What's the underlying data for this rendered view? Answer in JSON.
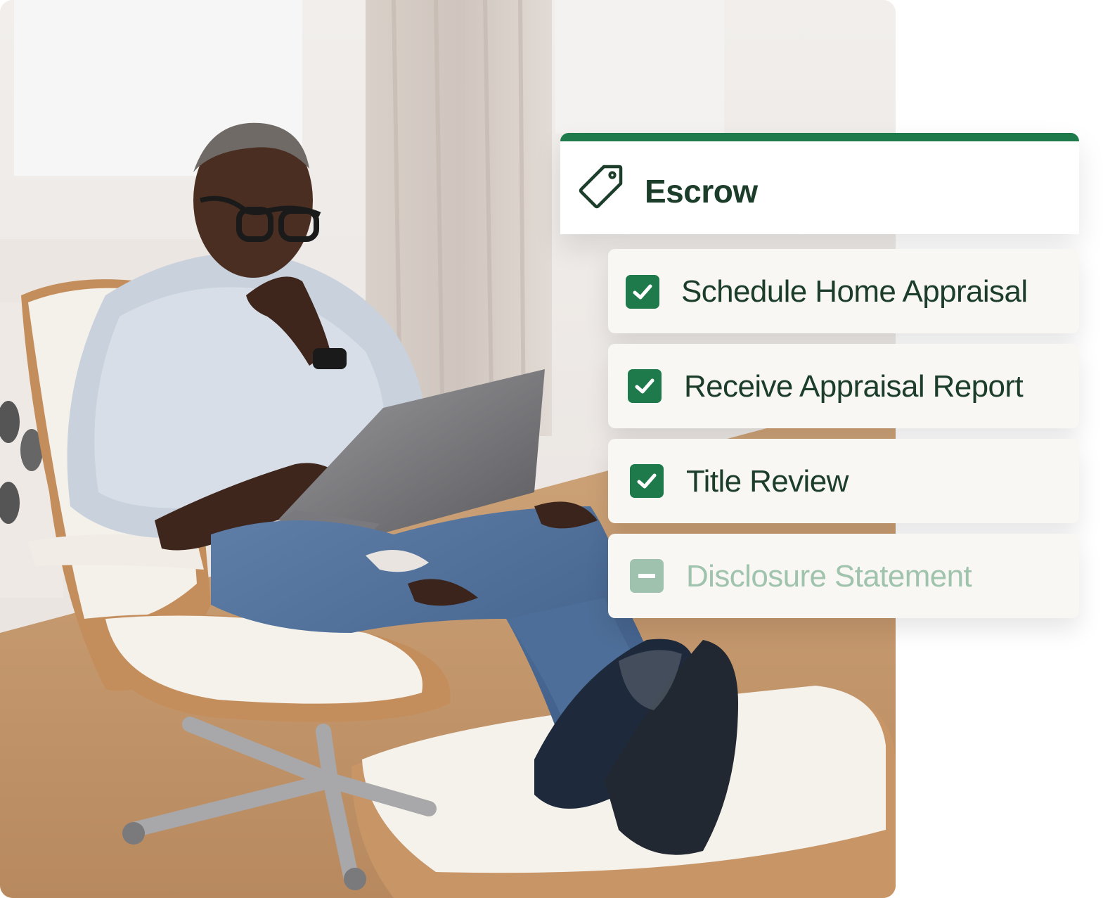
{
  "colors": {
    "accent": "#1e7a4a",
    "text_dark": "#1b3d2a",
    "text_muted": "#9fc3ad",
    "checkbox_muted": "#9ec2ad",
    "card_bg": "#f8f7f3"
  },
  "photo": {
    "alt": "Man in a lounge chair with a laptop"
  },
  "escrow": {
    "icon": "tag-icon",
    "title": "Escrow"
  },
  "tasks": [
    {
      "label": "Schedule Home Appraisal",
      "status": "checked",
      "icon": "checkbox-checked-icon"
    },
    {
      "label": "Receive Appraisal Report",
      "status": "checked",
      "icon": "checkbox-checked-icon"
    },
    {
      "label": "Title Review",
      "status": "checked",
      "icon": "checkbox-checked-icon"
    },
    {
      "label": "Disclosure Statement",
      "status": "indeterminate",
      "icon": "checkbox-indeterminate-icon"
    }
  ]
}
